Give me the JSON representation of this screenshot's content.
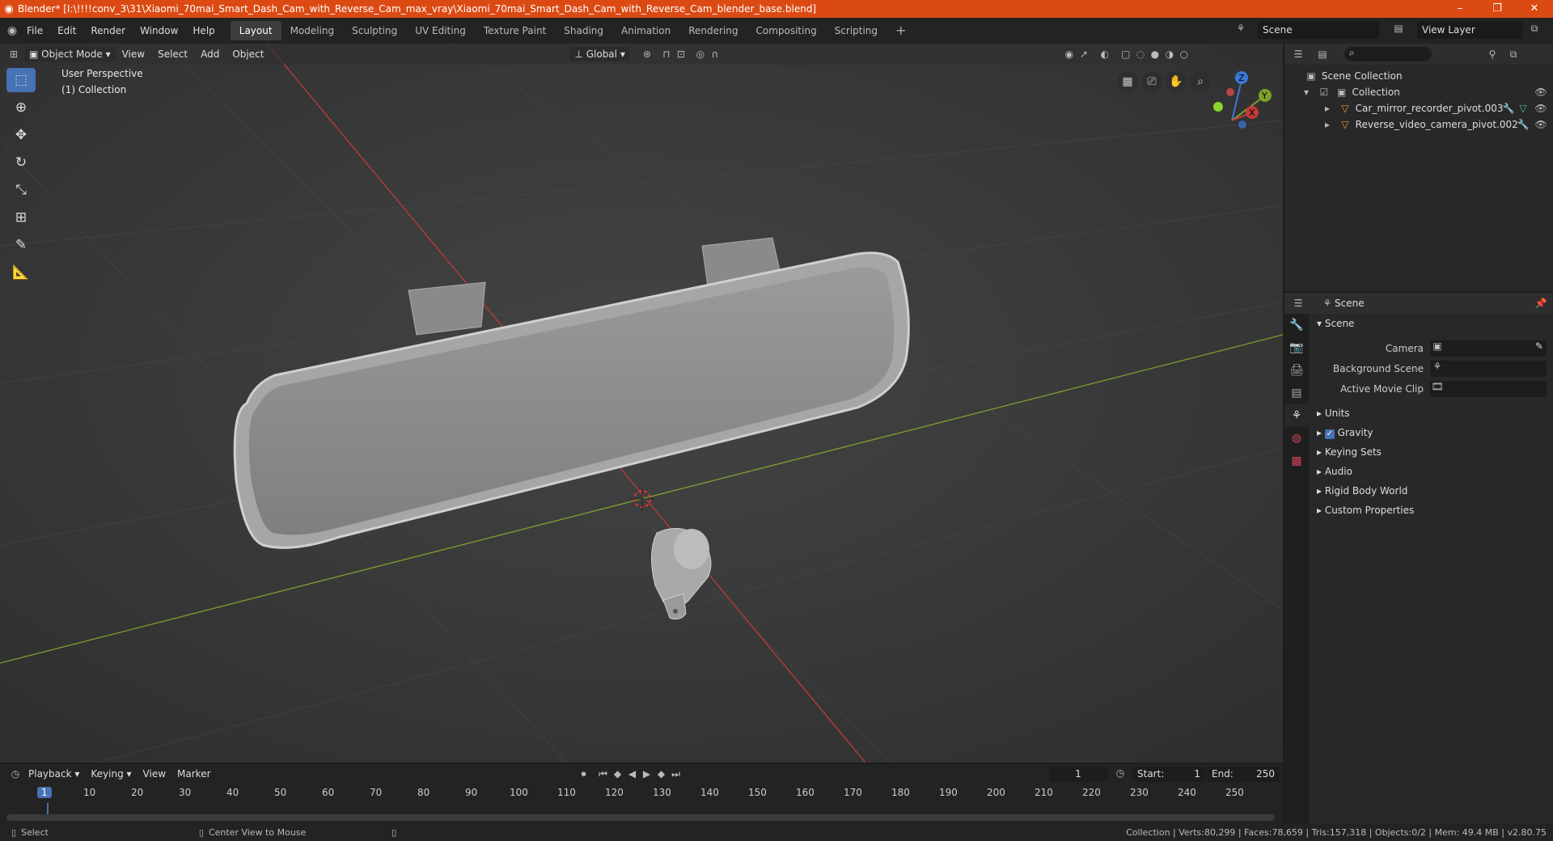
{
  "window": {
    "title": "Blender* [I:\\!!!!conv_3\\31\\Xiaomi_70mai_Smart_Dash_Cam_with_Reverse_Cam_max_vray\\Xiaomi_70mai_Smart_Dash_Cam_with_Reverse_Cam_blender_base.blend]",
    "minimize": "–",
    "maximize": "❐",
    "close": "✕"
  },
  "menu": [
    "File",
    "Edit",
    "Render",
    "Window",
    "Help"
  ],
  "workspaces": [
    "Layout",
    "Modeling",
    "Sculpting",
    "UV Editing",
    "Texture Paint",
    "Shading",
    "Animation",
    "Rendering",
    "Compositing",
    "Scripting"
  ],
  "scene_selector": "Scene",
  "view_layer": "View Layer",
  "viewport": {
    "mode": "Object Mode",
    "menus": [
      "View",
      "Select",
      "Add",
      "Object"
    ],
    "transform": "Global",
    "perspective_label": "User Perspective",
    "collection_label": "(1) Collection",
    "gizmo": {
      "z": "Z",
      "y": "Y",
      "x": "X"
    }
  },
  "outliner": {
    "root": "Scene Collection",
    "collection": "Collection",
    "objects": [
      "Car_mirror_recorder_pivot.003",
      "Reverse_video_camera_pivot.002"
    ]
  },
  "properties": {
    "header": "Scene",
    "panel": "Scene",
    "fields": [
      {
        "label": "Camera"
      },
      {
        "label": "Background Scene"
      },
      {
        "label": "Active Movie Clip"
      }
    ],
    "subpanels": [
      "Units",
      "Gravity",
      "Keying Sets",
      "Audio",
      "Rigid Body World",
      "Custom Properties"
    ]
  },
  "timeline": {
    "menus": [
      "Playback",
      "Keying",
      "View",
      "Marker"
    ],
    "current_frame": "1",
    "start_label": "Start:",
    "start": "1",
    "end_label": "End:",
    "end": "250",
    "ticks": [
      "10",
      "20",
      "30",
      "40",
      "50",
      "60",
      "70",
      "80",
      "90",
      "100",
      "110",
      "120",
      "130",
      "140",
      "150",
      "160",
      "170",
      "180",
      "190",
      "200",
      "210",
      "220",
      "230",
      "240",
      "250"
    ],
    "cursor": "1"
  },
  "status": {
    "select": "Select",
    "center": "Center View to Mouse",
    "stats": "Collection | Verts:80,299 | Faces:78,659 | Tris:157,318 | Objects:0/2 | Mem: 49.4 MB | v2.80.75"
  },
  "colors": {
    "accent": "#4772b3",
    "titlebar": "#dc4a14",
    "x_axis": "#c23a3a",
    "y_axis": "#7ba12c"
  }
}
